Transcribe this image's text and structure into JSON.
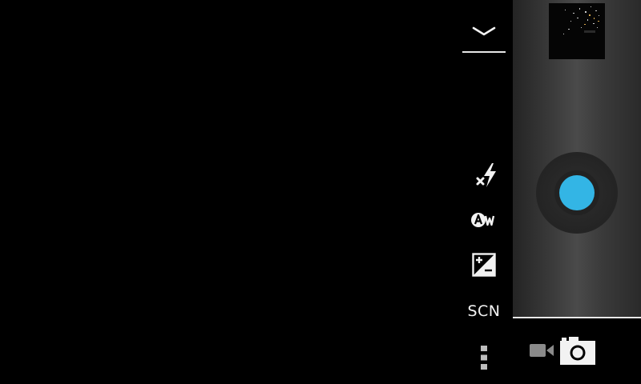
{
  "settings": {
    "collapse_icon": "chevron-down-icon",
    "flash_icon": "flash-off-icon",
    "white_balance_icon": "white-balance-auto-icon",
    "exposure_icon": "exposure-compensation-icon",
    "scene_label": "SCN",
    "overflow_icon": "more-vertical-icon"
  },
  "shutter_panel": {
    "thumbnail_icon": "last-photo-thumbnail",
    "shutter_icon": "shutter-button",
    "accent_color": "#33b5e5"
  },
  "mode_switcher": {
    "video_icon": "video-camera-icon",
    "photo_icon": "photo-camera-icon"
  },
  "colors": {
    "viewfinder": "#000000",
    "icon": "#f2f2f2",
    "accent": "#33b5e5"
  }
}
